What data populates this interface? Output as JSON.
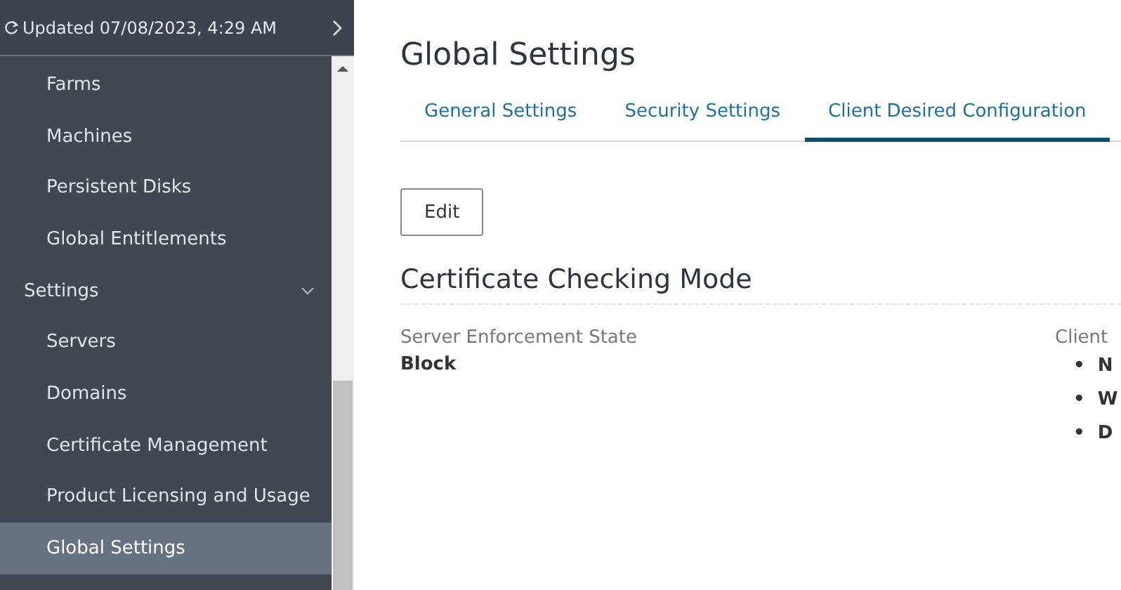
{
  "sidebar": {
    "updated": "Updated 07/08/2023, 4:29 AM",
    "items": [
      {
        "kind": "item",
        "label": "Farms",
        "selected": false
      },
      {
        "kind": "item",
        "label": "Machines",
        "selected": false
      },
      {
        "kind": "item",
        "label": "Persistent Disks",
        "selected": false
      },
      {
        "kind": "item",
        "label": "Global Entitlements",
        "selected": false
      },
      {
        "kind": "group",
        "label": "Settings",
        "expanded": true,
        "children": [
          {
            "label": "Servers",
            "selected": false
          },
          {
            "label": "Domains",
            "selected": false
          },
          {
            "label": "Certificate Management",
            "selected": false
          },
          {
            "label": "Product Licensing and Usage",
            "selected": false
          },
          {
            "label": "Global Settings",
            "selected": true
          }
        ]
      }
    ]
  },
  "page": {
    "title": "Global Settings",
    "tabs": [
      {
        "label": "General Settings",
        "selected": false
      },
      {
        "label": "Security Settings",
        "selected": false
      },
      {
        "label": "Client Desired Configuration",
        "selected": true
      }
    ],
    "edit_button": "Edit",
    "section": {
      "title": "Certificate Checking Mode",
      "server_label": "Server Enforcement State",
      "server_value": "Block",
      "client_label": "Client",
      "client_items": [
        {
          "bullet": "•",
          "text": "N"
        },
        {
          "bullet": "•",
          "text": "W"
        },
        {
          "bullet": "•",
          "text": "D"
        }
      ]
    }
  }
}
